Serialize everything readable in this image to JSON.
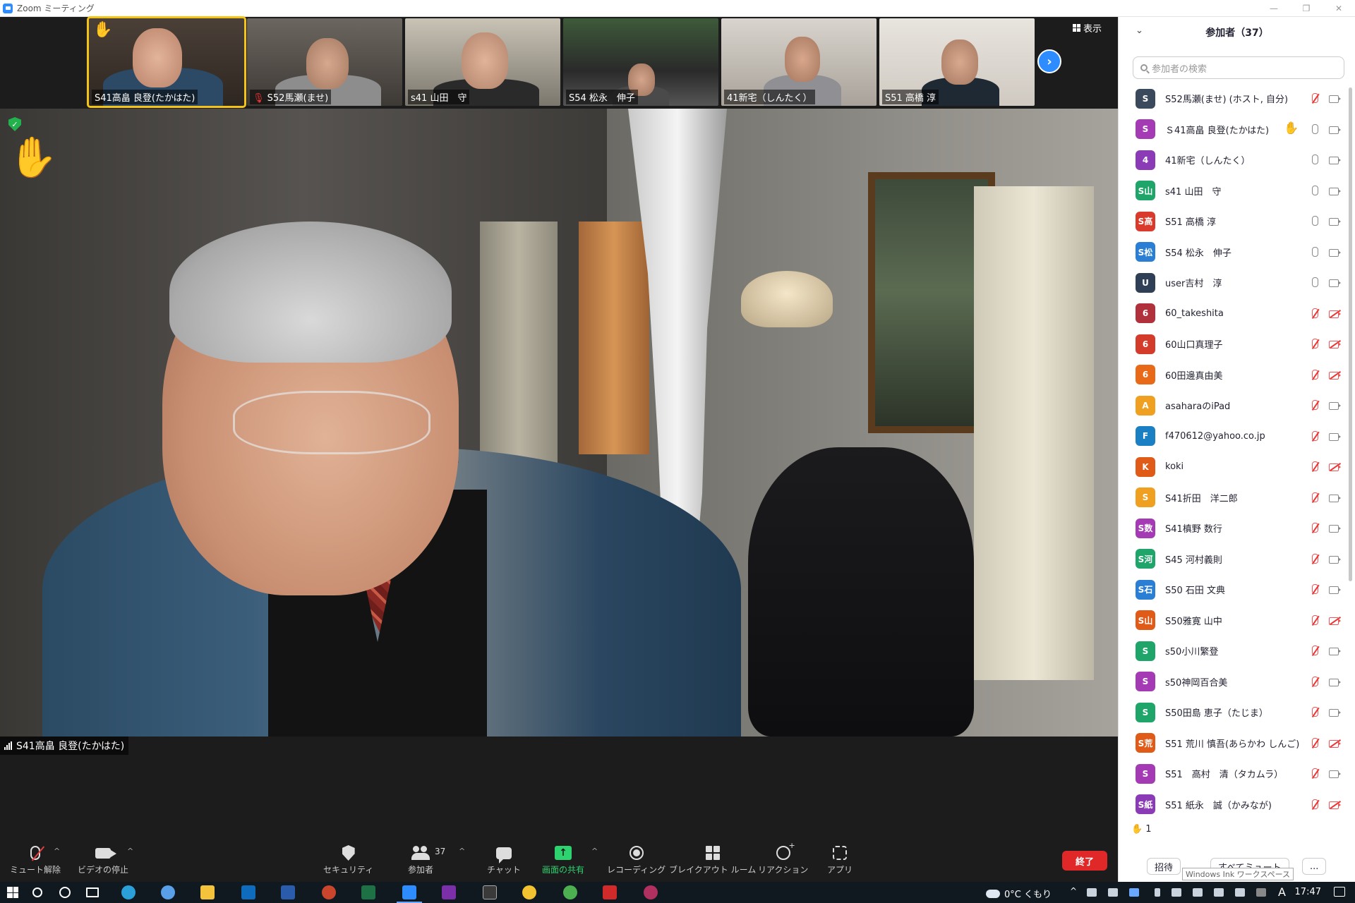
{
  "window": {
    "title": "Zoom ミーティング"
  },
  "gallery": {
    "thumbs": [
      {
        "label": "S41高畠 良登(たかはた)",
        "active": true,
        "hand": "✋"
      },
      {
        "label": "S52馬瀬(ませ)",
        "muted": true
      },
      {
        "label": "s41 山田　守"
      },
      {
        "label": "S54 松永　伸子"
      },
      {
        "label": "41新宅（しんたく）"
      },
      {
        "label": "S51 高橋 淳"
      }
    ],
    "view_label": "表示",
    "next_icon": "chevron-right-icon"
  },
  "main_video": {
    "speaker_name": "S41高畠 良登(たかはた)",
    "raised_hand": "✋"
  },
  "toolbar": {
    "mute_label": "ミュート解除",
    "video_label": "ビデオの停止",
    "security_label": "セキュリティ",
    "participants_label": "参加者",
    "participants_count": "37",
    "chat_label": "チャット",
    "share_label": "画面の共有",
    "record_label": "レコーディング",
    "breakout_label": "ブレイクアウト ルーム",
    "reactions_label": "リアクション",
    "apps_label": "アプリ",
    "end_label": "終了"
  },
  "panel": {
    "title": "参加者（37）",
    "search_placeholder": "参加者の検索",
    "participants": [
      {
        "initial": "S",
        "color": "#3a4a5c",
        "name": "S52馬瀬(ませ) (ホスト, 自分)",
        "mic": "muted",
        "cam": "on"
      },
      {
        "initial": "S",
        "color": "#a43bb5",
        "name": "Ｓ41高畠 良登(たかはた)",
        "hand": true,
        "mic": "on",
        "cam": "on"
      },
      {
        "initial": "4",
        "color": "#8b3bb5",
        "name": "41新宅（しんたく）",
        "mic": "on",
        "cam": "on"
      },
      {
        "initial": "S山",
        "color": "#1fa46a",
        "name": "s41 山田　守",
        "mic": "on",
        "cam": "on"
      },
      {
        "initial": "S高",
        "color": "#d93a2b",
        "name": "S51 高橋 淳",
        "mic": "on",
        "cam": "on"
      },
      {
        "initial": "S松",
        "color": "#2a7fd4",
        "name": "S54 松永　伸子",
        "mic": "on",
        "cam": "on"
      },
      {
        "initial": "U",
        "color": "#2e3f56",
        "name": "user吉村　淳",
        "mic": "on",
        "cam": "on"
      },
      {
        "initial": "6",
        "color": "#b0303c",
        "name": "60_takeshita",
        "mic": "muted",
        "cam": "off"
      },
      {
        "initial": "6",
        "color": "#d33b2a",
        "name": "60山口真理子",
        "mic": "muted",
        "cam": "off"
      },
      {
        "initial": "6",
        "color": "#e86a18",
        "name": "60田邊真由美",
        "mic": "muted",
        "cam": "off"
      },
      {
        "initial": "A",
        "color": "#f0a020",
        "name": "asaharaのiPad",
        "mic": "muted",
        "cam": "on"
      },
      {
        "initial": "F",
        "color": "#1b7fc4",
        "name": "f470612@yahoo.co.jp",
        "mic": "muted",
        "cam": "on"
      },
      {
        "initial": "K",
        "color": "#e05a18",
        "name": "koki",
        "mic": "muted",
        "cam": "off"
      },
      {
        "initial": "S",
        "color": "#f0a020",
        "name": "S41折田　洋二郎",
        "mic": "muted",
        "cam": "on"
      },
      {
        "initial": "S数",
        "color": "#a43bb5",
        "name": "S41槙野 数行",
        "mic": "muted",
        "cam": "on"
      },
      {
        "initial": "S河",
        "color": "#1fa46a",
        "name": "S45 河村義則",
        "mic": "muted",
        "cam": "on"
      },
      {
        "initial": "S石",
        "color": "#2a7fd4",
        "name": "S50 石田 文典",
        "mic": "muted",
        "cam": "on"
      },
      {
        "initial": "S山",
        "color": "#e05a18",
        "name": "S50雅寛 山中",
        "mic": "muted",
        "cam": "off"
      },
      {
        "initial": "S",
        "color": "#1fa46a",
        "name": "s50小川繁登",
        "mic": "muted",
        "cam": "on"
      },
      {
        "initial": "S",
        "color": "#a43bb5",
        "name": "s50神岡百合美",
        "mic": "muted",
        "cam": "on"
      },
      {
        "initial": "S",
        "color": "#1fa46a",
        "name": "S50田島 恵子（たじま）",
        "mic": "muted",
        "cam": "on"
      },
      {
        "initial": "S荒",
        "color": "#e05a18",
        "name": "S51 荒川 慎吾(あらかわ しんご)",
        "mic": "muted",
        "cam": "off"
      },
      {
        "initial": "S",
        "color": "#a43bb5",
        "name": "S51　高村　清（タカムラ）",
        "mic": "muted",
        "cam": "on"
      },
      {
        "initial": "S紙",
        "color": "#8b3bb5",
        "name": "S51 紙永　誠（かみなが)",
        "mic": "muted",
        "cam": "off"
      }
    ],
    "raised_hands_count": "1",
    "invite_label": "招待",
    "mute_all_label": "すべてミュート",
    "more_label": "...",
    "tooltip": "Windows Ink ワークスペース"
  },
  "taskbar": {
    "weather": "0°C くもり",
    "time": "17:47",
    "ime": "A"
  }
}
